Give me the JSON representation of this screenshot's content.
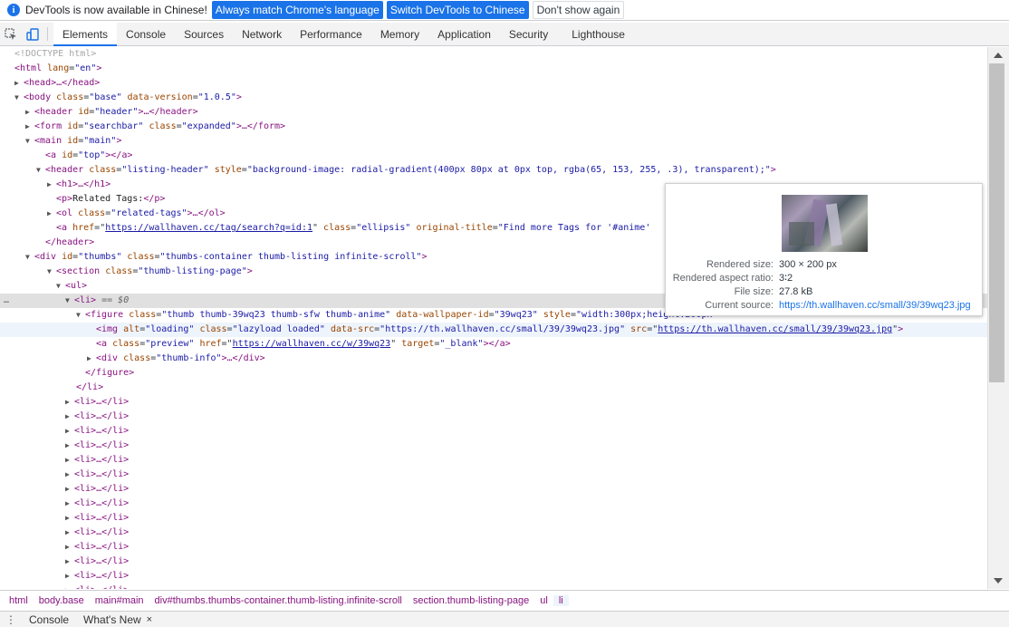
{
  "infobar": {
    "message": "DevTools is now available in Chinese!",
    "btn_match": "Always match Chrome's language",
    "btn_switch": "Switch DevTools to Chinese",
    "btn_dismiss": "Don't show again"
  },
  "tabs": [
    "Elements",
    "Console",
    "Sources",
    "Network",
    "Performance",
    "Memory",
    "Application",
    "Security",
    "Lighthouse"
  ],
  "active_tab": "Elements",
  "tree": {
    "l0": "<!DOCTYPE html>",
    "l1_open": "<html",
    "l1_lang_n": "lang",
    "l1_lang_v": "\"en\"",
    "l2_head": "<head>…</head>",
    "l3_body": "<body",
    "l3_class_n": "class",
    "l3_class_v": "\"base\"",
    "l3_ver_n": "data-version",
    "l3_ver_v": "\"1.0.5\"",
    "l4_header": "<header",
    "l4_id_n": "id",
    "l4_id_v": "\"header\"",
    "l4_end": ">…</header>",
    "l5_form": "<form",
    "l5_id_n": "id",
    "l5_id_v": "\"searchbar\"",
    "l5_class_n": "class",
    "l5_class_v": "\"expanded\"",
    "l5_end": ">…</form>",
    "l6_main": "<main",
    "l6_id_n": "id",
    "l6_id_v": "\"main\"",
    "l7_a": "<a",
    "l7_id_n": "id",
    "l7_id_v": "\"top\"",
    "l7_end": "></a>",
    "l8_header": "<header",
    "l8_class_n": "class",
    "l8_class_v": "\"listing-header\"",
    "l8_style_n": "style",
    "l8_style_v": "\"background-image: radial-gradient(400px 80px at 0px top, rgba(65, 153, 255, .3), transparent);\"",
    "l9_h1": "<h1>…</h1>",
    "l10_p_open": "<p>",
    "l10_text": "Related Tags:",
    "l10_p_close": "</p>",
    "l11_ol": "<ol",
    "l11_class_n": "class",
    "l11_class_v": "\"related-tags\"",
    "l11_end": ">…</ol>",
    "l12_a": "<a",
    "l12_href_n": "href",
    "l12_href_v": "https://wallhaven.cc/tag/search?q=id:1",
    "l12_class_n": "class",
    "l12_class_v": "\"ellipsis\"",
    "l12_title_n": "original-title",
    "l12_title_v": "\"Find more Tags for '#anime'",
    "l13_close": "</header>",
    "l14_div": "<div",
    "l14_id_n": "id",
    "l14_id_v": "\"thumbs\"",
    "l14_class_n": "class",
    "l14_class_v": "\"thumbs-container thumb-listing infinite-scroll\"",
    "l15_section": "<section",
    "l15_class_n": "class",
    "l15_class_v": "\"thumb-listing-page\"",
    "l16_ul": "<ul>",
    "l17_li": "<li>",
    "l17_eq": " == $0",
    "l18_fig": "<figure",
    "l18_class_n": "class",
    "l18_class_v": "\"thumb thumb-39wq23 thumb-sfw thumb-anime\"",
    "l18_id_n": "data-wallpaper-id",
    "l18_id_v": "\"39wq23\"",
    "l18_style_n": "style",
    "l18_style_v": "\"width:300px;height:200px\"",
    "l19_img": "<img",
    "l19_alt_n": "alt",
    "l19_alt_v": "\"loading\"",
    "l19_class_n": "class",
    "l19_class_v": "\"lazyload loaded\"",
    "l19_dsrc_n": "data-src",
    "l19_dsrc_v": "\"https://th.wallhaven.cc/small/39/39wq23.jpg\"",
    "l19_src_n": "src",
    "l19_src_v": "https://th.wallhaven.cc/small/39/39wq23.jpg",
    "l20_a": "<a",
    "l20_class_n": "class",
    "l20_class_v": "\"preview\"",
    "l20_href_n": "href",
    "l20_href_v": "https://wallhaven.cc/w/39wq23",
    "l20_target_n": "target",
    "l20_target_v": "\"_blank\"",
    "l20_end": "></a>",
    "l21_div": "<div",
    "l21_class_n": "class",
    "l21_class_v": "\"thumb-info\"",
    "l21_end": ">…</div>",
    "l22_close": "</figure>",
    "l23_close": "</li>",
    "li_collapsed": "<li>…</li>"
  },
  "tooltip": {
    "rendered_size_label": "Rendered size:",
    "rendered_size_value": "300 × 200 px",
    "aspect_label": "Rendered aspect ratio:",
    "aspect_value": "3∶2",
    "filesize_label": "File size:",
    "filesize_value": "27.8 kB",
    "source_label": "Current source:",
    "source_value": "https://th.wallhaven.cc/small/39/39wq23.jpg"
  },
  "breadcrumbs": [
    "html",
    "body.base",
    "main#main",
    "div#thumbs.thumbs-container.thumb-listing.infinite-scroll",
    "section.thumb-listing-page",
    "ul",
    "li"
  ],
  "drawer": {
    "tab_console": "Console",
    "tab_whats_new": "What's New",
    "close": "×"
  },
  "colors": {
    "accent": "#1a73e8",
    "tag": "#881280",
    "attr_name": "#994500",
    "attr_value": "#1a1aa6"
  }
}
